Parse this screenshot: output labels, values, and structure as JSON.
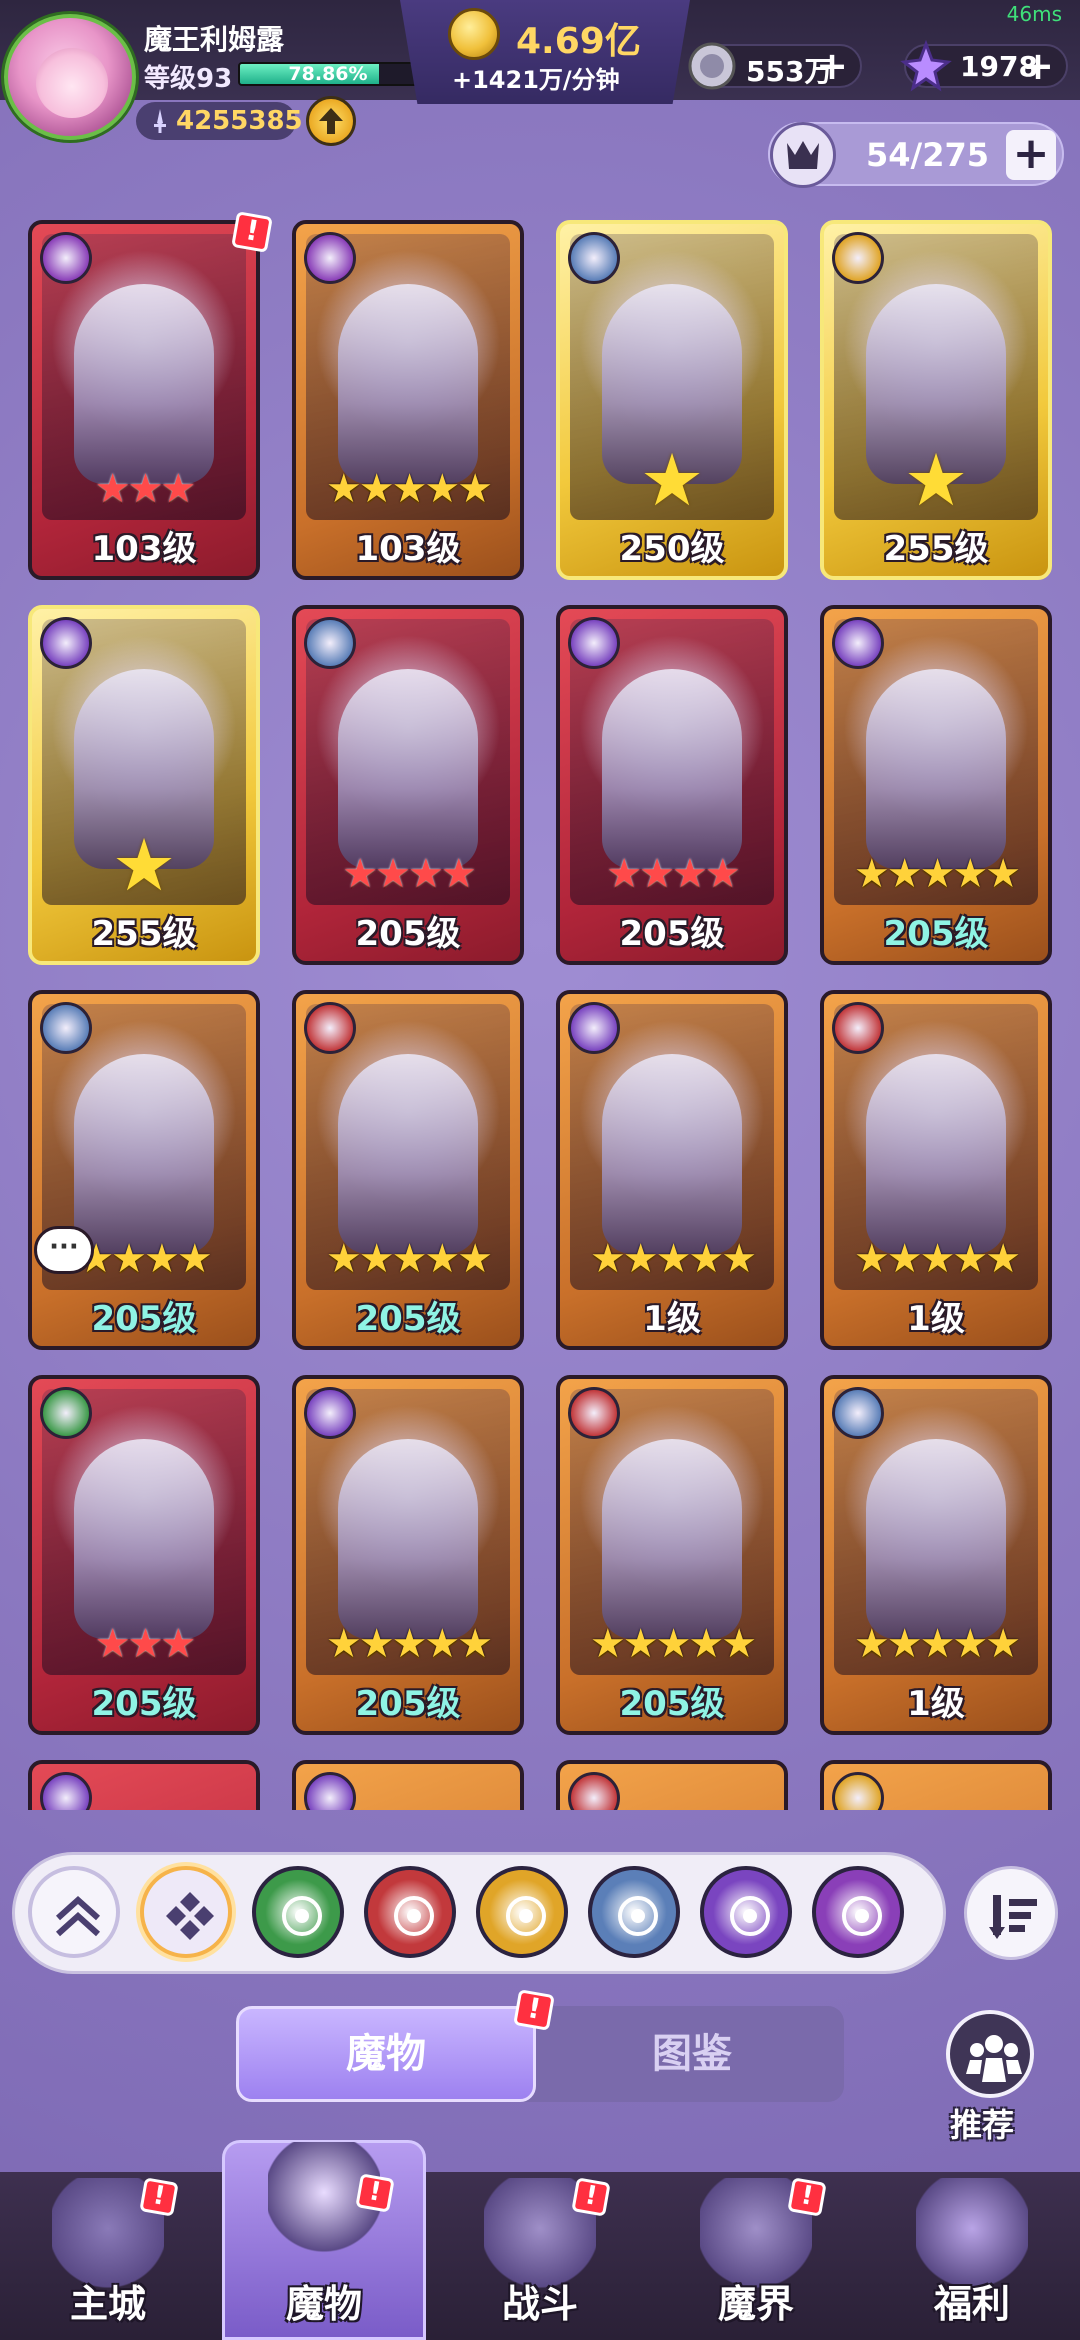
{
  "status": {
    "ping": "46ms"
  },
  "player": {
    "name": "魔王利姆露",
    "level": "等级93",
    "xp_percent": "78.86%",
    "xp_fraction": 0.7886,
    "power": "4255385"
  },
  "currency": {
    "gold": "4.69亿",
    "gold_rate": "+1421万/分钟",
    "gems": "553万",
    "crystals": "1978",
    "plus": "+"
  },
  "capacity": {
    "text": "54/275",
    "plus": "+"
  },
  "cards": [
    {
      "level": "103级",
      "stars": "★★★",
      "star_style": "red",
      "frame": "red",
      "faction": "purple-swirl",
      "alert": "!"
    },
    {
      "level": "103级",
      "stars": "★★★★★",
      "star_style": "gold",
      "frame": "orange",
      "faction": "purple-swirl"
    },
    {
      "level": "250级",
      "stars": "★",
      "star_style": "big",
      "frame": "gold",
      "faction": "wolf"
    },
    {
      "level": "255级",
      "stars": "★",
      "star_style": "big",
      "frame": "gold",
      "faction": "hourglass"
    },
    {
      "level": "255级",
      "stars": "★",
      "star_style": "big",
      "frame": "gold",
      "faction": "eye"
    },
    {
      "level": "205级",
      "stars": "★★★★",
      "star_style": "red",
      "frame": "red",
      "faction": "wolf"
    },
    {
      "level": "205级",
      "stars": "★★★★",
      "star_style": "red",
      "frame": "red",
      "faction": "eye"
    },
    {
      "level": "205级",
      "stars": "★★★★★",
      "star_style": "gold",
      "frame": "orange",
      "faction": "eye",
      "teal": true
    },
    {
      "level": "205级",
      "stars": "★★★★",
      "star_style": "gold",
      "frame": "orange",
      "faction": "wolf",
      "teal": true,
      "chat": "···"
    },
    {
      "level": "205级",
      "stars": "★★★★★",
      "star_style": "gold",
      "frame": "orange",
      "faction": "demon",
      "teal": true
    },
    {
      "level": "1级",
      "stars": "★★★★★",
      "star_style": "gold",
      "frame": "orange",
      "faction": "eye"
    },
    {
      "level": "1级",
      "stars": "★★★★★",
      "star_style": "gold",
      "frame": "orange",
      "faction": "demon"
    },
    {
      "level": "205级",
      "stars": "★★★",
      "star_style": "red",
      "frame": "red",
      "faction": "leaf",
      "teal": true
    },
    {
      "level": "205级",
      "stars": "★★★★★",
      "star_style": "gold",
      "frame": "orange",
      "faction": "eye",
      "teal": true
    },
    {
      "level": "205级",
      "stars": "★★★★★",
      "star_style": "gold",
      "frame": "orange",
      "faction": "demon",
      "teal": true
    },
    {
      "level": "1级",
      "stars": "★★★★★",
      "star_style": "gold",
      "frame": "orange",
      "faction": "wolf"
    }
  ],
  "filters": [
    {
      "name": "collapse"
    },
    {
      "name": "all"
    },
    {
      "name": "leaf",
      "color": "#3d9a4a"
    },
    {
      "name": "demon",
      "color": "#c2393c"
    },
    {
      "name": "hourglass",
      "color": "#e0a528"
    },
    {
      "name": "wolf",
      "color": "#5b7fb8"
    },
    {
      "name": "eye",
      "color": "#7a45c0"
    },
    {
      "name": "swirl",
      "color": "#8a3fb8"
    }
  ],
  "tabs": {
    "monster": "魔物",
    "codex": "图鉴",
    "recommend": "推荐"
  },
  "nav": [
    {
      "label": "主城",
      "badge": "!"
    },
    {
      "label": "魔物",
      "badge": "!"
    },
    {
      "label": "战斗",
      "badge": "!"
    },
    {
      "label": "魔界",
      "badge": "!"
    },
    {
      "label": "福利"
    }
  ],
  "colors": {
    "faction_purple": "#7a45c0",
    "faction_wolf": "#5b7fb8",
    "faction_demon": "#c2393c",
    "faction_hourglass": "#e0a528",
    "faction_leaf": "#3d9a4a",
    "alert": "#ff3040"
  }
}
